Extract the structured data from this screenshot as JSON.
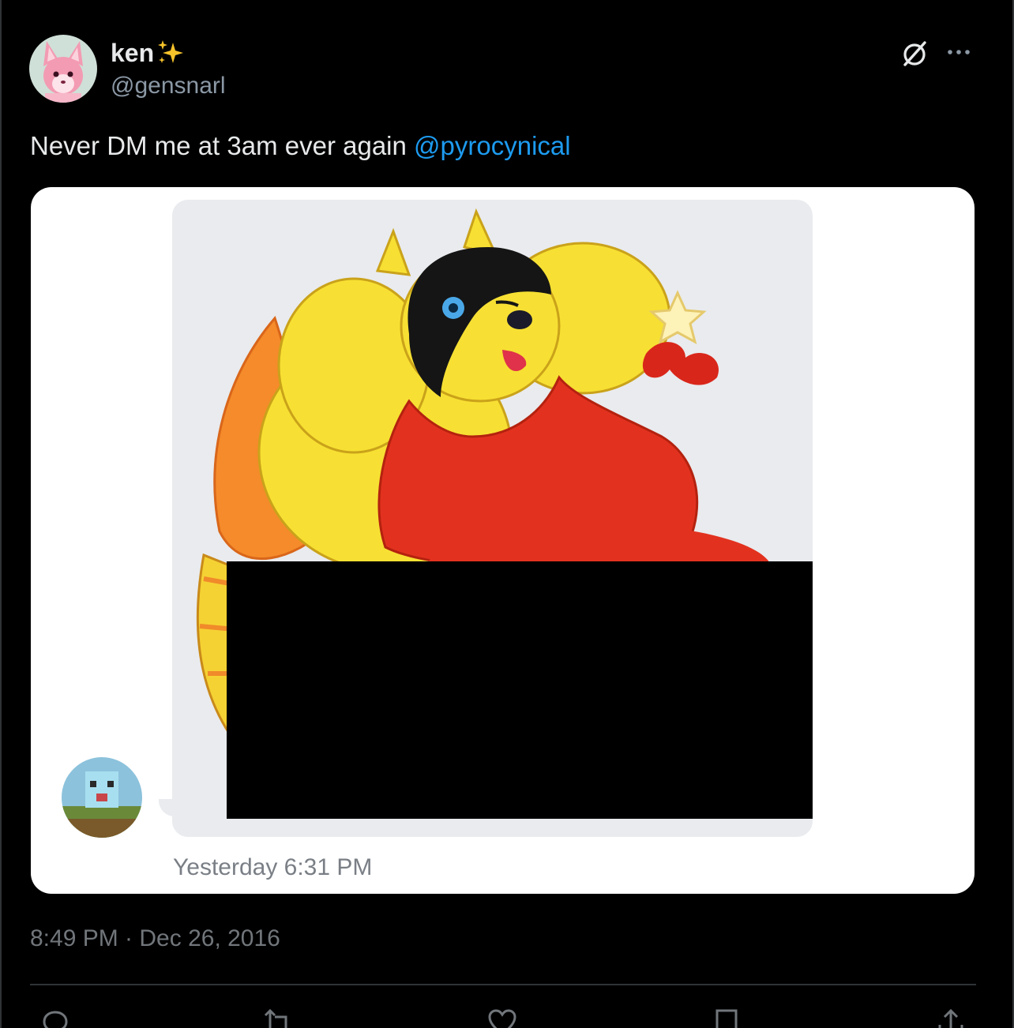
{
  "tweet": {
    "author": {
      "display_name": "ken",
      "handle": "@gensnarl",
      "avatar": "pink-fox-avatar",
      "name_emoji": "sparkles-icon"
    },
    "text_prefix": "Never DM me at 3am ever again ",
    "mention": "@pyrocynical",
    "timestamp": "8:49 PM · Dec 26, 2016"
  },
  "header_actions": {
    "grok_icon": "grok-icon",
    "more_icon": "more-icon"
  },
  "media": {
    "dm_timestamp": "Yesterday 6:31 PM",
    "content": "dm-screenshot-with-cartoon-dragon-image",
    "censor": "black-redaction-box"
  },
  "actions": [
    {
      "name": "reply-icon"
    },
    {
      "name": "retweet-icon"
    },
    {
      "name": "like-icon"
    },
    {
      "name": "bookmark-icon"
    },
    {
      "name": "share-icon"
    }
  ],
  "colors": {
    "background": "#000000",
    "text": "#e7e9ea",
    "muted": "#71767b",
    "mention": "#1d9bf0",
    "divider": "#2f3336"
  }
}
